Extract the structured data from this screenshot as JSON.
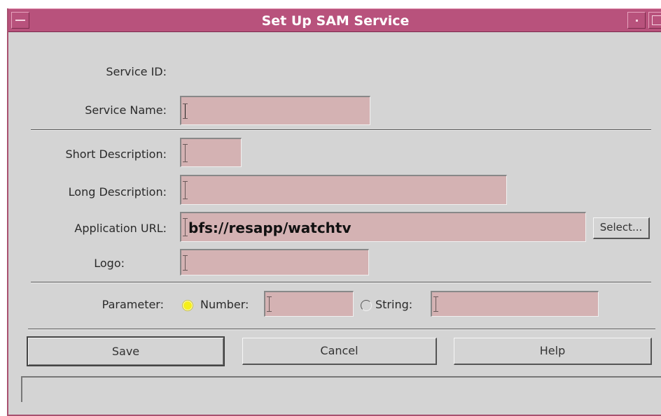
{
  "window": {
    "title": "Set Up SAM Service"
  },
  "form": {
    "service_id_label": "Service ID:",
    "service_name_label": "Service Name:",
    "service_name_value": "",
    "short_desc_label": "Short Description:",
    "short_desc_value": "",
    "long_desc_label": "Long Description:",
    "long_desc_value": "",
    "app_url_label": "Application URL:",
    "app_url_value": "bfs://resapp/watchtv",
    "select_label": "Select...",
    "logo_label": "Logo:",
    "logo_value": "",
    "parameter_label": "Parameter:",
    "number_label": "Number:",
    "number_value": "",
    "number_selected": true,
    "string_label": "String:",
    "string_value": "",
    "string_selected": false
  },
  "buttons": {
    "save": "Save",
    "cancel": "Cancel",
    "help": "Help"
  },
  "status": {
    "text": ""
  },
  "colors": {
    "titlebar": "#b8527c",
    "field": "#d4b2b3",
    "window": "#d4d4d4",
    "radio_selected": "#f5ef1a"
  }
}
